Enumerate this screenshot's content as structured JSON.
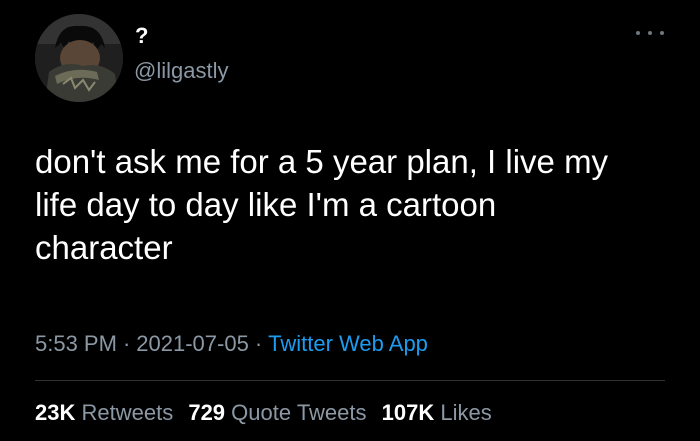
{
  "tweet": {
    "author": {
      "display_name": "?",
      "handle": "@lilgastly",
      "avatar_icon": "profile-photo"
    },
    "more_icon": "more-dots-icon",
    "text": "don't ask me for a 5 year plan, I live my\nlife day to day like I'm a cartoon\ncharacter",
    "meta": {
      "time": "5:53 PM",
      "date": "2021-07-05",
      "separator": "·",
      "source": "Twitter Web App"
    },
    "stats": {
      "retweets_count": "23K",
      "retweets_label": "Retweets",
      "quotes_count": "729",
      "quotes_label": "Quote Tweets",
      "likes_count": "107K",
      "likes_label": "Likes"
    }
  },
  "colors": {
    "background": "#000000",
    "text": "#ffffff",
    "secondary": "#8b98a5",
    "link": "#1d9bf0",
    "divider": "#2f3336"
  }
}
